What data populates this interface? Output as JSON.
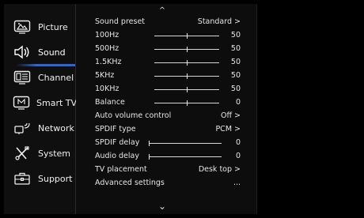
{
  "sidebar": {
    "items": [
      {
        "label": "Picture",
        "icon": "picture-icon"
      },
      {
        "label": "Sound",
        "icon": "speaker-icon",
        "active": true
      },
      {
        "label": "Channel",
        "icon": "channel-icon"
      },
      {
        "label": "Smart TV",
        "icon": "smart-tv-icon"
      },
      {
        "label": "Network",
        "icon": "network-icon"
      },
      {
        "label": "System",
        "icon": "tools-icon"
      },
      {
        "label": "Support",
        "icon": "toolbox-icon"
      }
    ],
    "accent_color": "#2c66d6"
  },
  "scroll": {
    "up": "^",
    "down": "⌄"
  },
  "sound": {
    "rows": [
      {
        "label": "Sound preset",
        "value": "Standard  >"
      },
      {
        "label": "100Hz",
        "value": "50",
        "slider": 0.5
      },
      {
        "label": "500Hz",
        "value": "50",
        "slider": 0.5
      },
      {
        "label": "1.5KHz",
        "value": "50",
        "slider": 0.5
      },
      {
        "label": "5KHz",
        "value": "50",
        "slider": 0.5
      },
      {
        "label": "10KHz",
        "value": "50",
        "slider": 0.5
      },
      {
        "label": "Balance",
        "value": "0",
        "slider": 0.5
      },
      {
        "label": "Auto volume control",
        "value": "Off  >"
      },
      {
        "label": "SPDIF type",
        "value": "PCM  >"
      },
      {
        "label": "SPDIF delay",
        "value": "0",
        "slider": 0
      },
      {
        "label": "Audio delay",
        "value": "0",
        "slider": 0
      },
      {
        "label": "TV placement",
        "value": "Desk top  >"
      },
      {
        "label": "Advanced settings",
        "value": "..."
      }
    ]
  }
}
